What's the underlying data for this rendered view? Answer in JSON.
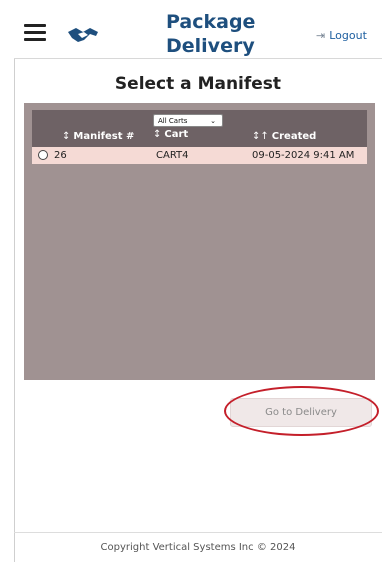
{
  "header": {
    "app_title_line1": "Package",
    "app_title_line2": "Delivery",
    "logout_label": "Logout",
    "menu_icon": "hamburger-menu-icon",
    "logo_icon": "handshake-logo-icon"
  },
  "page": {
    "title": "Select a Manifest"
  },
  "table": {
    "filter": {
      "selected": "All Carts"
    },
    "columns": [
      {
        "label": "Manifest #",
        "sort_glyph": "↕"
      },
      {
        "label": "Cart",
        "sort_glyph": "↕"
      },
      {
        "label": "Created",
        "sort_glyph": "↕↑"
      }
    ],
    "rows": [
      {
        "manifest": "26",
        "cart": "CART4",
        "created": "09-05-2024 9:41 AM",
        "selected": false
      }
    ]
  },
  "actions": {
    "go_to_delivery_label": "Go to Delivery"
  },
  "footer": {
    "copyright": "Copyright Vertical Systems Inc © 2024"
  },
  "colors": {
    "brand_blue": "#1e4f7e",
    "table_header_bg": "#6e6265",
    "panel_bg": "#a09292",
    "row_bg": "#f5dad5",
    "annotation_red": "#c41f2a"
  }
}
